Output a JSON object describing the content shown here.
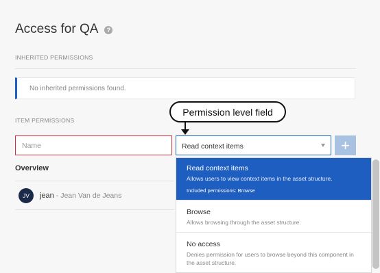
{
  "page": {
    "title": "Access for QA",
    "help_icon": "?"
  },
  "inherited": {
    "label": "INHERITED PERMISSIONS",
    "empty_text": "No inherited permissions found."
  },
  "item_permissions": {
    "label": "ITEM PERMISSIONS",
    "name_placeholder": "Name",
    "selected_level": "Read context items",
    "add_label": "+"
  },
  "callout": {
    "text": "Permission level field"
  },
  "overview": {
    "label": "Overview",
    "users": [
      {
        "initials": "JV",
        "username": "jean",
        "full_name": "- Jean Van de Jeans"
      }
    ]
  },
  "dropdown": {
    "options": [
      {
        "title": "Read context items",
        "description": "Allows users to view context items in the asset structure.",
        "extra": "Included permissions: Browse",
        "selected": true
      },
      {
        "title": "Browse",
        "description": "Allows browsing through the asset structure.",
        "selected": false
      },
      {
        "title": "No access",
        "description": "Denies permission for users to browse beyond this component in the asset structure.",
        "selected": false
      }
    ]
  },
  "colors": {
    "accent": "#1e5ec0",
    "error_border": "#d0323a",
    "avatar_bg": "#1c2a4a",
    "add_button_disabled": "#a9c2e2"
  }
}
